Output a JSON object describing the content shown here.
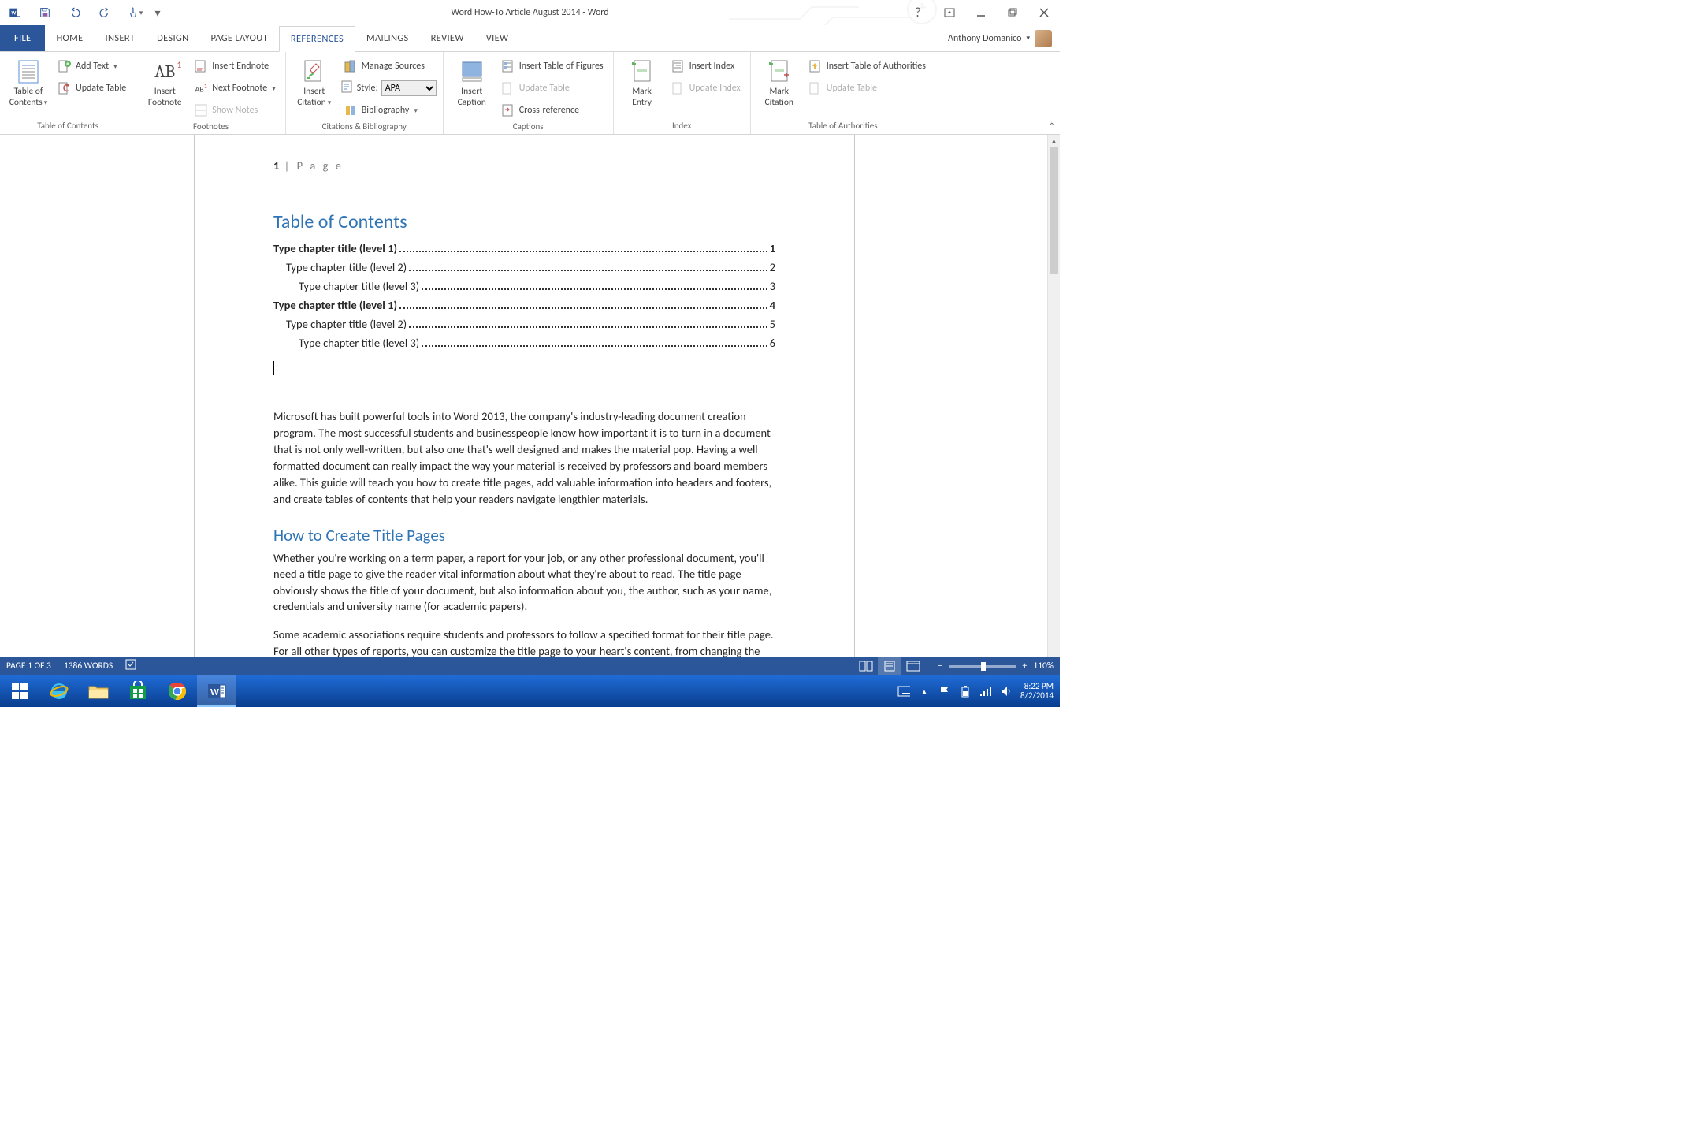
{
  "title": "Word How-To Article August 2014 - Word",
  "account_name": "Anthony Domanico",
  "tabs": {
    "file": "FILE",
    "home": "HOME",
    "insert": "INSERT",
    "design": "DESIGN",
    "page_layout": "PAGE LAYOUT",
    "references": "REFERENCES",
    "mailings": "MAILINGS",
    "review": "REVIEW",
    "view": "VIEW"
  },
  "ribbon": {
    "toc": {
      "big": "Table of\nContents",
      "add_text": "Add Text",
      "update": "Update Table",
      "group": "Table of Contents"
    },
    "footnotes": {
      "big": "Insert\nFootnote",
      "endnote": "Insert Endnote",
      "next": "Next Footnote",
      "show": "Show Notes",
      "group": "Footnotes"
    },
    "citations": {
      "big": "Insert\nCitation",
      "manage": "Manage Sources",
      "style_label": "Style:",
      "style_value": "APA",
      "bibliography": "Bibliography",
      "group": "Citations & Bibliography"
    },
    "captions": {
      "big": "Insert\nCaption",
      "figures": "Insert Table of Figures",
      "update": "Update Table",
      "cross": "Cross-reference",
      "group": "Captions"
    },
    "index": {
      "big": "Mark\nEntry",
      "insert": "Insert Index",
      "update": "Update Index",
      "group": "Index"
    },
    "authorities": {
      "big": "Mark\nCitation",
      "insert": "Insert Table of Authorities",
      "update": "Update Table",
      "group": "Table of Authorities"
    }
  },
  "document": {
    "page_number_prefix": "1",
    "page_number_label": " | P a g e",
    "toc_heading": "Table of Contents",
    "toc_entries": [
      {
        "level": 1,
        "text": "Type chapter title (level 1)",
        "page": "1"
      },
      {
        "level": 2,
        "text": "Type chapter title (level 2)",
        "page": "2"
      },
      {
        "level": 3,
        "text": "Type chapter title (level 3)",
        "page": "3"
      },
      {
        "level": 1,
        "text": "Type chapter title (level 1)",
        "page": "4"
      },
      {
        "level": 2,
        "text": "Type chapter title (level 2)",
        "page": "5"
      },
      {
        "level": 3,
        "text": "Type chapter title (level 3)",
        "page": "6"
      }
    ],
    "intro_para": "Microsoft has built powerful tools into Word 2013, the company's industry-leading document creation program. The most successful students and businesspeople know how important it is to turn in a document that is not only well-written, but also one that's well designed and makes the material pop. Having a well formatted document can really impact the way your material is received by professors and board members alike. This guide will teach you how to create title pages, add valuable information into headers and footers, and create tables of contents that help your readers navigate lengthier materials.",
    "section_heading": "How to Create Title Pages",
    "section_p1": "Whether you're working on a term paper, a report for your job, or any other professional document, you'll need a title page to give the reader vital information about what they're about to read. The title page obviously shows the title of your document, but also information about you, the author, such as your name, credentials and university name (for academic papers).",
    "section_p2": "Some academic associations require students and professors to follow a specified format for their title page. For all other types of reports, you can customize the title page to your heart's content, from changing the font to adding illustrations to give your reader a sense of what's to come."
  },
  "status": {
    "page": "PAGE 1 OF 3",
    "words": "1386 WORDS",
    "zoom": "110%"
  },
  "taskbar": {
    "time": "8:22 PM",
    "date": "8/2/2014"
  }
}
